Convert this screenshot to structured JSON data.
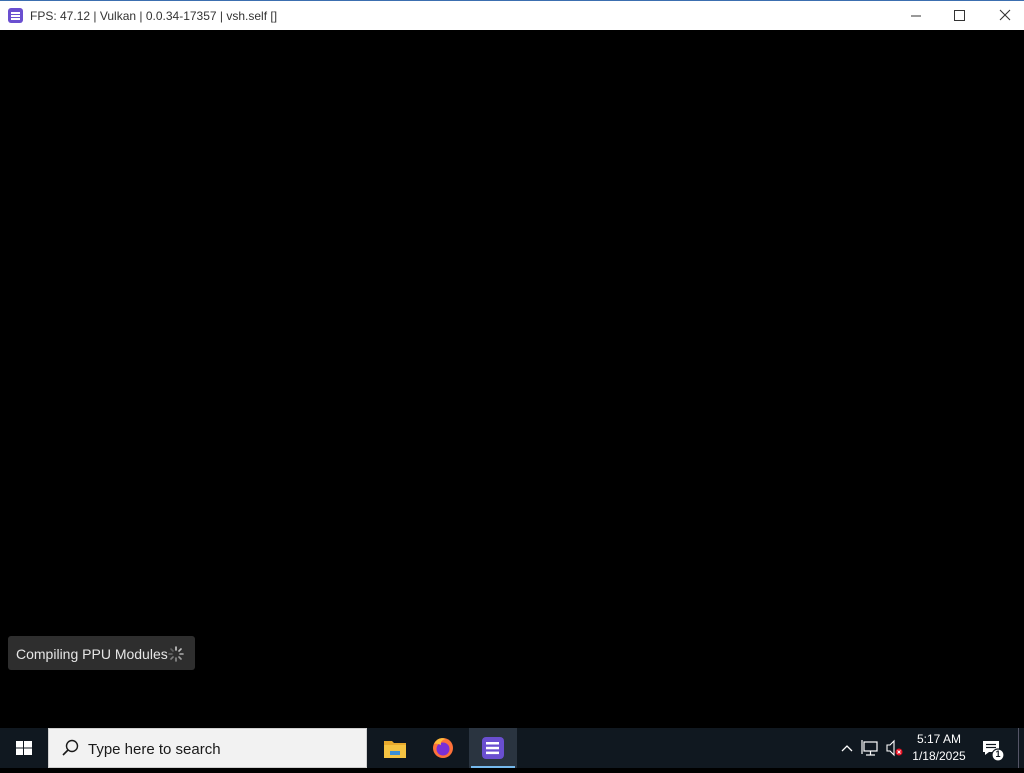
{
  "window": {
    "title": "FPS: 47.12 | Vulkan | 0.0.34-17357 | vsh.self []",
    "icon": "rpcs3-app-icon",
    "controls": [
      "minimize-icon",
      "maximize-icon",
      "close-icon"
    ]
  },
  "notification": {
    "text": "Compiling PPU Modules",
    "icon": "spinner-icon"
  },
  "taskbar": {
    "start_icon": "windows-logo-icon",
    "search_placeholder": "Type here to search",
    "apps": [
      {
        "name": "File Explorer",
        "icon": "folder-icon",
        "active": false
      },
      {
        "name": "Firefox",
        "icon": "firefox-icon",
        "active": false
      },
      {
        "name": "RPCS3",
        "icon": "rpcs3-app-icon",
        "active": true
      }
    ],
    "tray": {
      "icons": [
        "chevron-up-icon",
        "network-icon",
        "volume-muted-icon",
        "action-center-icon"
      ],
      "time": "5:17 AM",
      "date": "1/18/2025",
      "notification_count": "1"
    }
  },
  "colors": {
    "accent": "#6a4fd0",
    "taskbar_bg": "#101820",
    "active_indicator": "#76b9ed"
  }
}
